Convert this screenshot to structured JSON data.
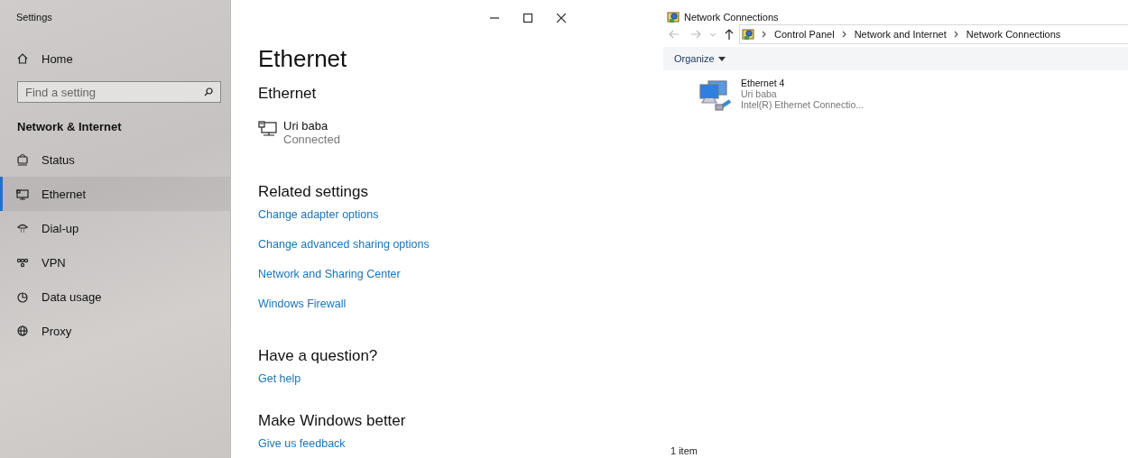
{
  "settings_window": {
    "title": "Settings",
    "sidebar": {
      "home": "Home",
      "search": {
        "placeholder": "Find a setting"
      },
      "section": "Network & Internet",
      "items": [
        {
          "label": "Status",
          "kind": "status",
          "selected": false
        },
        {
          "label": "Ethernet",
          "kind": "ethernet",
          "selected": true
        },
        {
          "label": "Dial-up",
          "kind": "dialup",
          "selected": false
        },
        {
          "label": "VPN",
          "kind": "vpn",
          "selected": false
        },
        {
          "label": "Data usage",
          "kind": "data",
          "selected": false
        },
        {
          "label": "Proxy",
          "kind": "proxy",
          "selected": false
        }
      ]
    },
    "content": {
      "page_title": "Ethernet",
      "section_title": "Ethernet",
      "network": {
        "name": "Uri baba",
        "status": "Connected"
      },
      "related_settings": {
        "heading": "Related settings",
        "links": [
          "Change adapter options",
          "Change advanced sharing options",
          "Network and Sharing Center",
          "Windows Firewall"
        ]
      },
      "question": {
        "heading": "Have a question?",
        "link": "Get help"
      },
      "feedback": {
        "heading": "Make Windows better",
        "link": "Give us feedback"
      }
    }
  },
  "explorer_window": {
    "title": "Network Connections",
    "breadcrumbs": [
      "Control Panel",
      "Network and Internet",
      "Network Connections"
    ],
    "toolbar": {
      "organize": "Organize"
    },
    "items": [
      {
        "name": "Ethernet 4",
        "network": "Uri baba",
        "device": "Intel(R) Ethernet Connectio..."
      }
    ],
    "status_bar": "1 item"
  }
}
